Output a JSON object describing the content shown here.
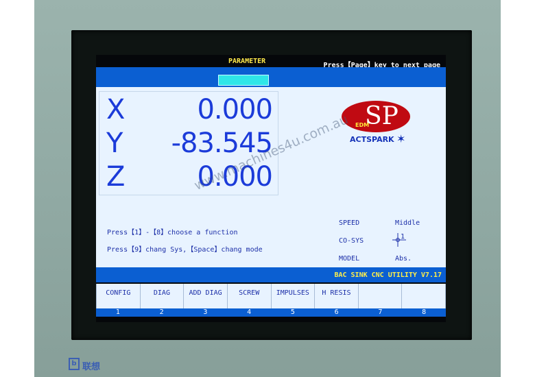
{
  "header": {
    "title": "PARAMETER",
    "hint": "Press【Page】key to next page"
  },
  "coordinates": [
    {
      "axis": "X",
      "value": "0.000"
    },
    {
      "axis": "Y",
      "value": "-83.545"
    },
    {
      "axis": "Z",
      "value": "0.000"
    }
  ],
  "logo": {
    "mark": "SP",
    "edm": "EDM",
    "brand": "ACTSPARK",
    "star_icon": "spark-star-icon"
  },
  "help": {
    "line1": "Press【1】-【8】choose a function",
    "line2": "Press【9】chang Sys,【Space】chang mode"
  },
  "status": [
    {
      "label": "SPEED",
      "value": "Middle"
    },
    {
      "label": "CO-SYS",
      "value": "1"
    },
    {
      "label": "MODEL",
      "value": "Abs."
    }
  ],
  "version": "BAC SINK CNC UTILITY V7.17",
  "softkeys": [
    {
      "label": "CONFIG",
      "key": "1"
    },
    {
      "label": "DIAG",
      "key": "2"
    },
    {
      "label": "ADD DIAG",
      "key": "3"
    },
    {
      "label": "SCREW",
      "key": "4"
    },
    {
      "label": "IMPULSES",
      "key": "5"
    },
    {
      "label": "H RESIS",
      "key": "6"
    },
    {
      "label": "",
      "key": "7"
    },
    {
      "label": "",
      "key": "8"
    }
  ],
  "watermark": "www.machines4u.com.au",
  "maker": {
    "logo_text": "b",
    "name": "联想"
  },
  "colors": {
    "screen_blue": "#0b5fd2",
    "panel": "#e8f3ff",
    "digits": "#1b3bd9",
    "title_yellow": "#ffe94a",
    "sp_red": "#c00a12"
  }
}
